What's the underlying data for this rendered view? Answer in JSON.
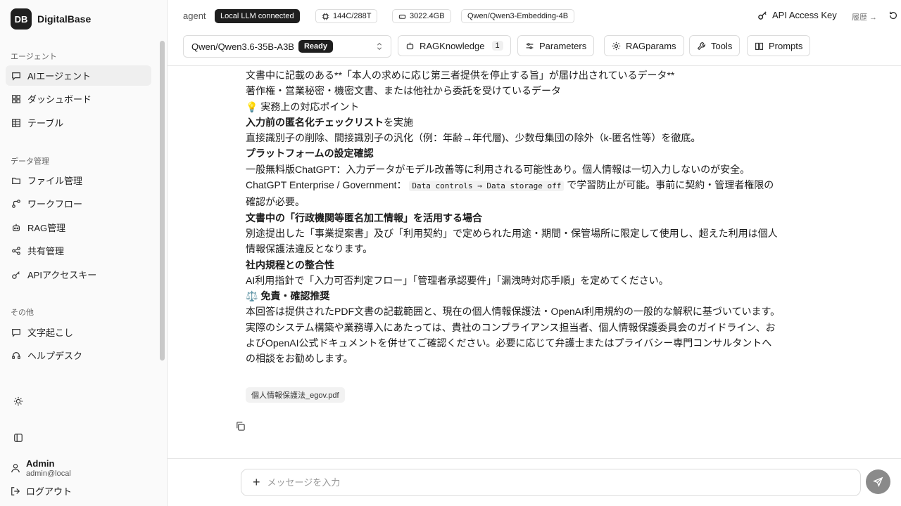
{
  "brand": {
    "logo": "DB",
    "name": "DigitalBase"
  },
  "sidebar": {
    "sections": [
      {
        "title": "エージェント",
        "items": [
          {
            "label": "AIエージェント",
            "icon": "chat-icon"
          },
          {
            "label": "ダッシュボード",
            "icon": "dashboard-icon"
          },
          {
            "label": "テーブル",
            "icon": "table-icon"
          }
        ]
      },
      {
        "title": "データ管理",
        "items": [
          {
            "label": "ファイル管理",
            "icon": "folder-icon"
          },
          {
            "label": "ワークフロー",
            "icon": "workflow-icon"
          },
          {
            "label": "RAG管理",
            "icon": "robot-icon"
          },
          {
            "label": "共有管理",
            "icon": "share-icon"
          },
          {
            "label": "APIアクセスキー",
            "icon": "key-icon"
          }
        ]
      },
      {
        "title": "その他",
        "items": [
          {
            "label": "文字起こし",
            "icon": "document-icon"
          },
          {
            "label": "ヘルプデスク",
            "icon": "headset-icon"
          }
        ]
      }
    ],
    "user": {
      "name": "Admin",
      "email": "admin@local"
    },
    "logout_label": "ログアウト"
  },
  "topbar": {
    "agent_label": "agent",
    "status": "Local LLM connected",
    "cpu": "144C/288T",
    "storage": "3022.4GB",
    "embedding": "Qwen/Qwen3-Embedding-4B",
    "api_key_label": "API Access Key",
    "history_label": "履歴 →",
    "model": "Qwen/Qwen3.6-35B-A3B",
    "model_status": "Ready",
    "buttons": {
      "rag_knowledge": "RAGKnowledge",
      "rag_count": "1",
      "parameters": "Parameters",
      "ragparams": "RAGparams",
      "tools": "Tools",
      "prompts": "Prompts"
    }
  },
  "chat": {
    "line1": "文書中に記載のある**「本人の求めに応じ第三者提供を停止する旨」が届け出されているデータ**",
    "line2": "著作権・営業秘密・機密文書、または他社から委託を受けているデータ",
    "line3": "💡 実務上の対応ポイント",
    "line4_bold": "入力前の匿名化チェックリスト",
    "line4_rest": "を実施",
    "line5": "直接識別子の削除、間接識別子の汎化（例：年齢→年代層)、少数母集団の除外（k-匿名性等）を徹底。",
    "line6": "プラットフォームの設定確認",
    "line7": "一般無料版ChatGPT：入力データがモデル改善等に利用される可能性あり。個人情報は一切入力しないのが安全。",
    "line8_pre": "ChatGPT Enterprise / Government：",
    "line8_code": "Data controls → Data storage off",
    "line8_post": "で学習防止が可能。事前に契約・管理者権限の確認が必要。",
    "line9": "文書中の「行政機関等匿名加工情報」を活用する場合",
    "line10": "別途提出した「事業提案書」及び「利用契約」で定められた用途・期間・保管場所に限定して使用し、超えた利用は個人情報保護法違反となります。",
    "line11": "社内規程との整合性",
    "line12": "AI利用指針で「入力可否判定フロー」「管理者承認要件」「漏洩時対応手順」を定めてください。",
    "line13": "⚖️ 免責・確認推奨",
    "line14": "本回答は提供されたPDF文書の記載範囲と、現在の個人情報保護法・OpenAI利用規約の一般的な解釈に基づいています。実際のシステム構築や業務導入にあたっては、貴社のコンプライアンス担当者、個人情報保護委員会のガイドライン、およびOpenAI公式ドキュメントを併せてご確認ください。必要に応じて弁護士またはプライバシー専門コンサルタントへの相談をお勧めします。",
    "file_chip": "個人情報保護法_egov.pdf"
  },
  "input": {
    "placeholder": "メッセージを入力"
  }
}
